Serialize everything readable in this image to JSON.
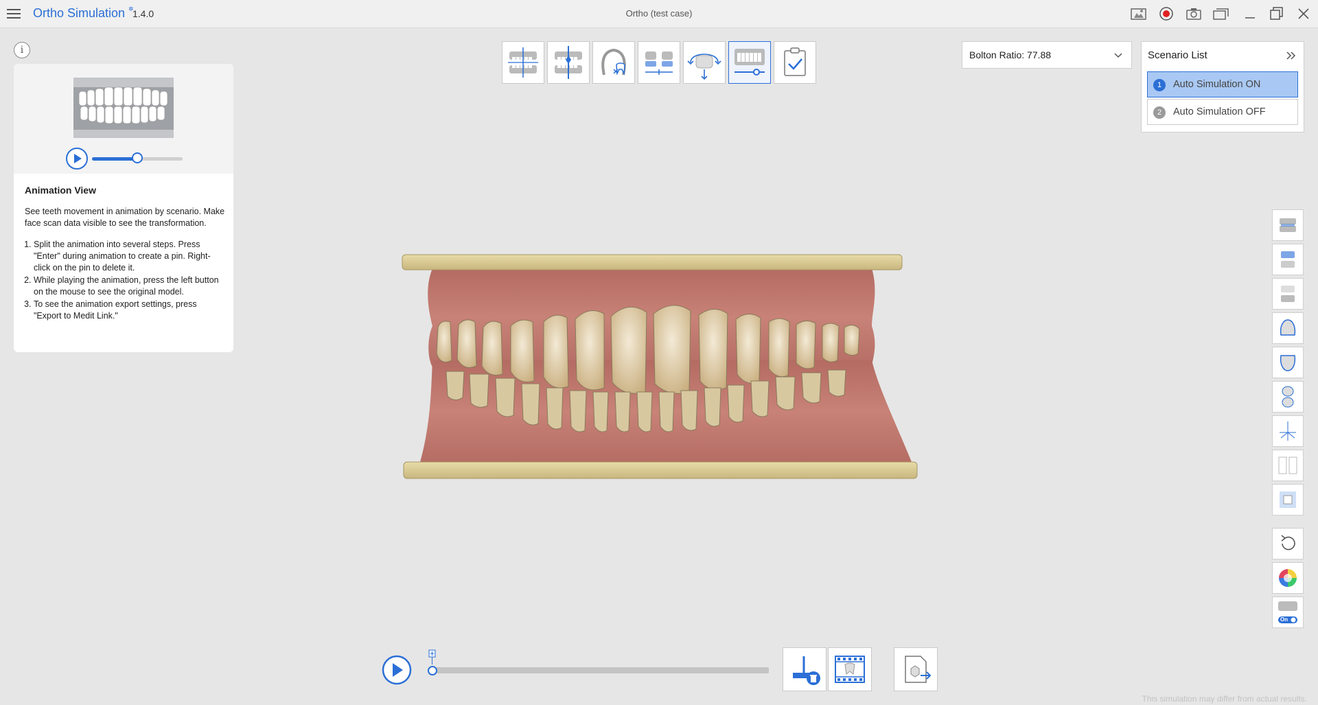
{
  "app": {
    "name": "Ortho Simulation",
    "version": "1.4.0",
    "window_title": "Ortho (test case)",
    "accent_color": "#2b6fd6"
  },
  "titlebar_icons": [
    "photo-capture-icon",
    "record-icon",
    "camera-icon",
    "gallery-icon",
    "minimize-icon",
    "restore-icon",
    "close-icon"
  ],
  "info_panel": {
    "info_button": "i",
    "preview_slider_value": 0.5,
    "title": "Animation View",
    "description": "See teeth movement in animation by scenario. Make face scan data visible to see the transformation.",
    "steps": [
      "Split the animation into several steps. Press \"Enter\" during animation to create a pin. Right-click on the pin to delete it.",
      "While playing the animation, press the left button on the mouse to see the original model.",
      "To see the animation export settings, press \"Export to Medit Link.\""
    ]
  },
  "top_tools": [
    "occlusion-view-icon",
    "midline-icon",
    "tooth-exclude-icon",
    "arch-alignment-icon",
    "rotation-icon",
    "animation-view-icon",
    "confirm-icon"
  ],
  "active_top_tool": 5,
  "bolton": {
    "label": "Bolton Ratio: 77.88"
  },
  "scenario_list": {
    "title": "Scenario List",
    "items": [
      {
        "num": "1",
        "label": "Auto Simulation ON"
      },
      {
        "num": "2",
        "label": "Auto Simulation OFF"
      }
    ],
    "selected": 0
  },
  "side_tools": [
    "both-jaws-icon",
    "upper-jaw-view-icon",
    "lower-jaw-view-icon",
    "maxilla-icon",
    "mandible-icon",
    "split-jaw-icon",
    "axis-icon",
    "split-view-icon",
    "cube-view-icon",
    "reset-view-icon",
    "color-wheel-icon",
    "auto-simulation-toggle-icon"
  ],
  "side_tools_toggle_label": "On",
  "timeline": {
    "progress": 0.0
  },
  "bottom_tools": [
    "add-pin-delete-icon",
    "film-frames-icon",
    "export-medit-link-icon"
  ],
  "footer_note": "This simulation may differ from actual results."
}
